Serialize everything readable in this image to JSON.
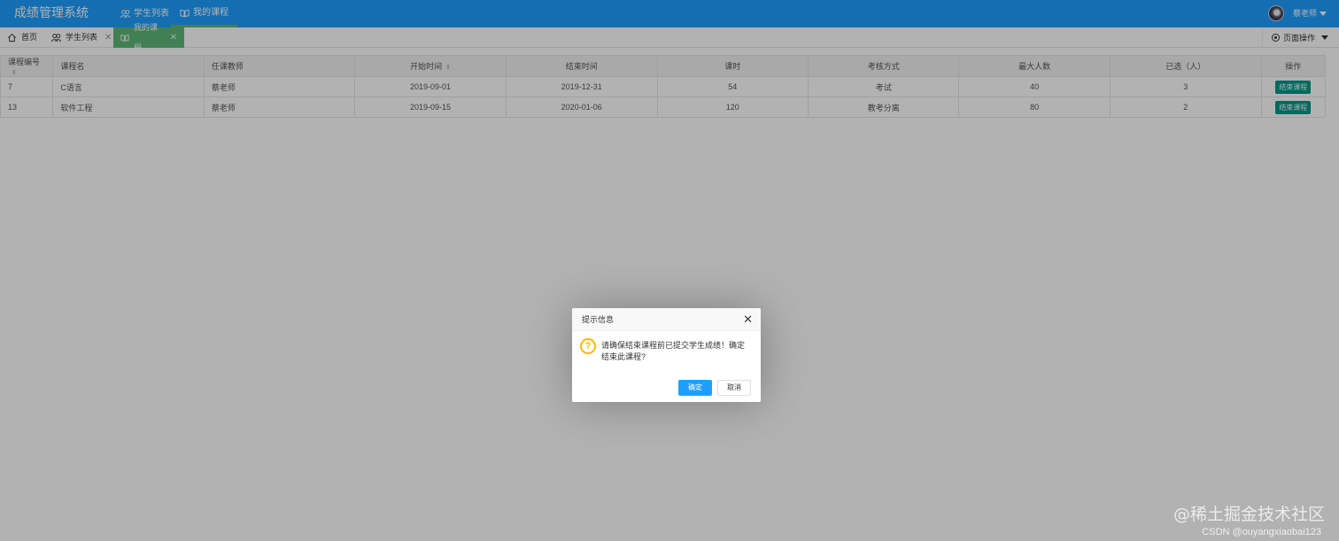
{
  "header": {
    "logo": "成绩管理系统",
    "nav": [
      {
        "label": "学生列表"
      },
      {
        "label": "我的课程"
      }
    ],
    "user": {
      "name": "蔡老师"
    }
  },
  "tabs": [
    {
      "label": "首页"
    },
    {
      "label": "学生列表"
    },
    {
      "label": "我的课程"
    }
  ],
  "page_ops": "页面操作",
  "table": {
    "headers": [
      "课程编号",
      "课程名",
      "任课教师",
      "开始时间",
      "结束时间",
      "课时",
      "考核方式",
      "最大人数",
      "已选（人）",
      "操作"
    ],
    "rows": [
      [
        "7",
        "C语言",
        "蔡老师",
        "2019-09-01",
        "2019-12-31",
        "54",
        "考试",
        "40",
        "3",
        "结束课程"
      ],
      [
        "13",
        "软件工程",
        "蔡老师",
        "2019-09-15",
        "2020-01-06",
        "120",
        "教考分离",
        "80",
        "2",
        "结束课程"
      ]
    ]
  },
  "dialog": {
    "title": "提示信息",
    "close": "✕",
    "message": "请确保结束课程前已提交学生成绩！确定结束此课程?",
    "confirm": "确定",
    "cancel": "取消"
  },
  "watermark": {
    "line1": "@稀土掘金技术社区",
    "line2": "CSDN @ouyangxiaobai123"
  },
  "colors": {
    "header_bg": "#1e9fff",
    "active_tab": "#5fb878",
    "action_button": "#009688",
    "dialog_primary": "#1e9fff",
    "question_icon": "#ffb800"
  }
}
